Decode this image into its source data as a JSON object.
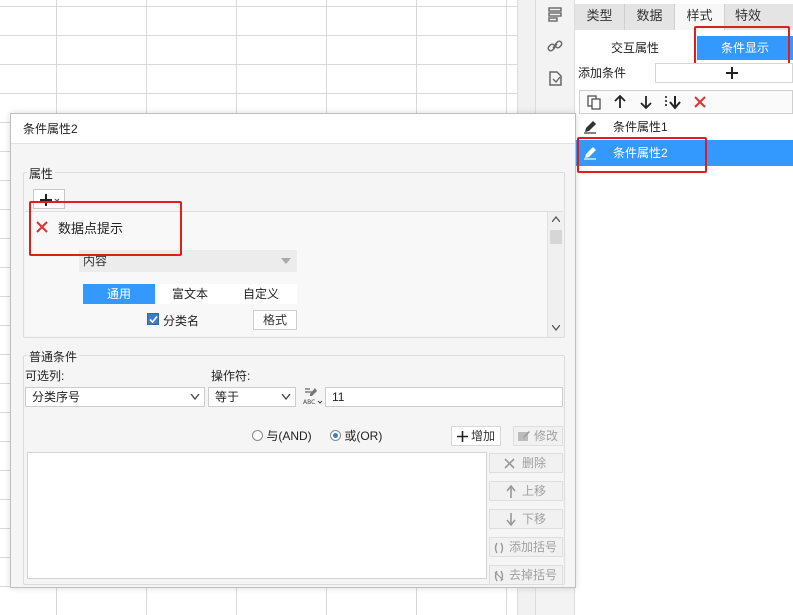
{
  "right_panel": {
    "tabs": [
      {
        "label": "类型"
      },
      {
        "label": "数据"
      },
      {
        "label": "样式"
      },
      {
        "label": "特效"
      }
    ],
    "subtabs": {
      "interaction": "交互属性",
      "condition_display": "条件显示"
    },
    "add_condition_label": "添加条件",
    "add_icon": "plus-icon",
    "toolbar_icons": [
      "copy-icon",
      "arrow-up-icon",
      "arrow-down-icon",
      "move-bottom-icon",
      "delete-icon"
    ],
    "conditions": [
      {
        "label": "条件属性1",
        "selected": false
      },
      {
        "label": "条件属性2",
        "selected": true
      }
    ],
    "selected_color": "#3399ff"
  },
  "dialog": {
    "title": "条件属性2",
    "properties_legend": "属性",
    "attribute": {
      "label": "数据点提示"
    },
    "content_select": "内容",
    "content_tabs": [
      {
        "label": "通用",
        "active": true
      },
      {
        "label": "富文本",
        "active": false
      },
      {
        "label": "自定义",
        "active": false
      }
    ],
    "category_checkbox": {
      "label": "分类名",
      "checked": true
    },
    "format_button": "格式",
    "normal_conditions_legend": "普通条件",
    "column_label": "可选列:",
    "column_value": "分类序号",
    "operator_label": "操作符:",
    "operator_value": "等于",
    "value": "11",
    "radio_and": "与(AND)",
    "radio_or": "或(OR)",
    "add_button": "增加",
    "modify_button": "修改",
    "delete_button": "删除",
    "move_up_button": "上移",
    "move_down_button": "下移",
    "add_bracket_button": "添加括号",
    "remove_bracket_button": "去掉括号"
  },
  "colors": {
    "accent": "#3399ff",
    "highlight_red": "#e01e1e",
    "delete_red": "#e03131"
  }
}
